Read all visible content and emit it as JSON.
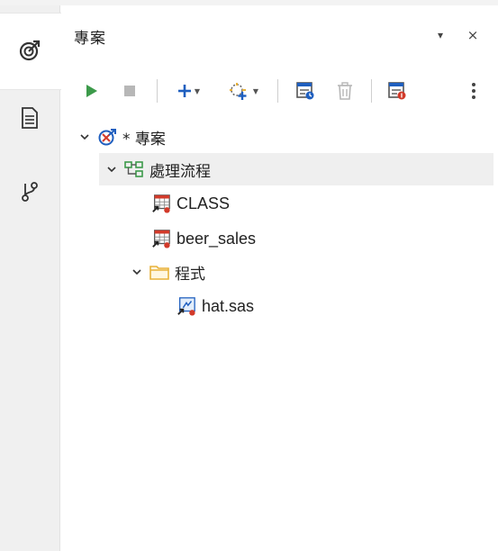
{
  "panel": {
    "title": "專案",
    "menu_glyph": "▾",
    "close_glyph": "×"
  },
  "rail": {
    "tabs": [
      {
        "icon": "projects-icon",
        "active": true
      },
      {
        "icon": "document-icon",
        "active": false
      },
      {
        "icon": "git-branch-icon",
        "active": false
      }
    ]
  },
  "toolbar": {
    "buttons": [
      {
        "icon": "run-icon",
        "enabled": true
      },
      {
        "icon": "stop-icon",
        "enabled": false
      },
      {
        "icon": "add-icon",
        "enabled": true,
        "dropdown": true
      },
      {
        "icon": "add-node-icon",
        "enabled": true,
        "dropdown": true
      },
      {
        "icon": "schedule-icon",
        "enabled": true
      },
      {
        "icon": "delete-icon",
        "enabled": false
      },
      {
        "icon": "properties-icon",
        "enabled": true
      },
      {
        "icon": "more-icon",
        "enabled": true
      }
    ]
  },
  "tree": {
    "root": {
      "label": "* 專案",
      "expanded": true
    },
    "flow": {
      "label": "處理流程",
      "expanded": true,
      "selected": true
    },
    "items": [
      {
        "label": "CLASS",
        "type": "table"
      },
      {
        "label": "beer_sales",
        "type": "table"
      }
    ],
    "folder": {
      "label": "程式",
      "expanded": true
    },
    "program": {
      "label": "hat.sas",
      "type": "sas-program"
    }
  },
  "colors": {
    "run_green": "#3c9a4a",
    "accent_blue": "#1f5fbf",
    "badge_red": "#d23a2a",
    "folder_yellow": "#e8b23a",
    "disabled_gray": "#b7b7b7"
  }
}
